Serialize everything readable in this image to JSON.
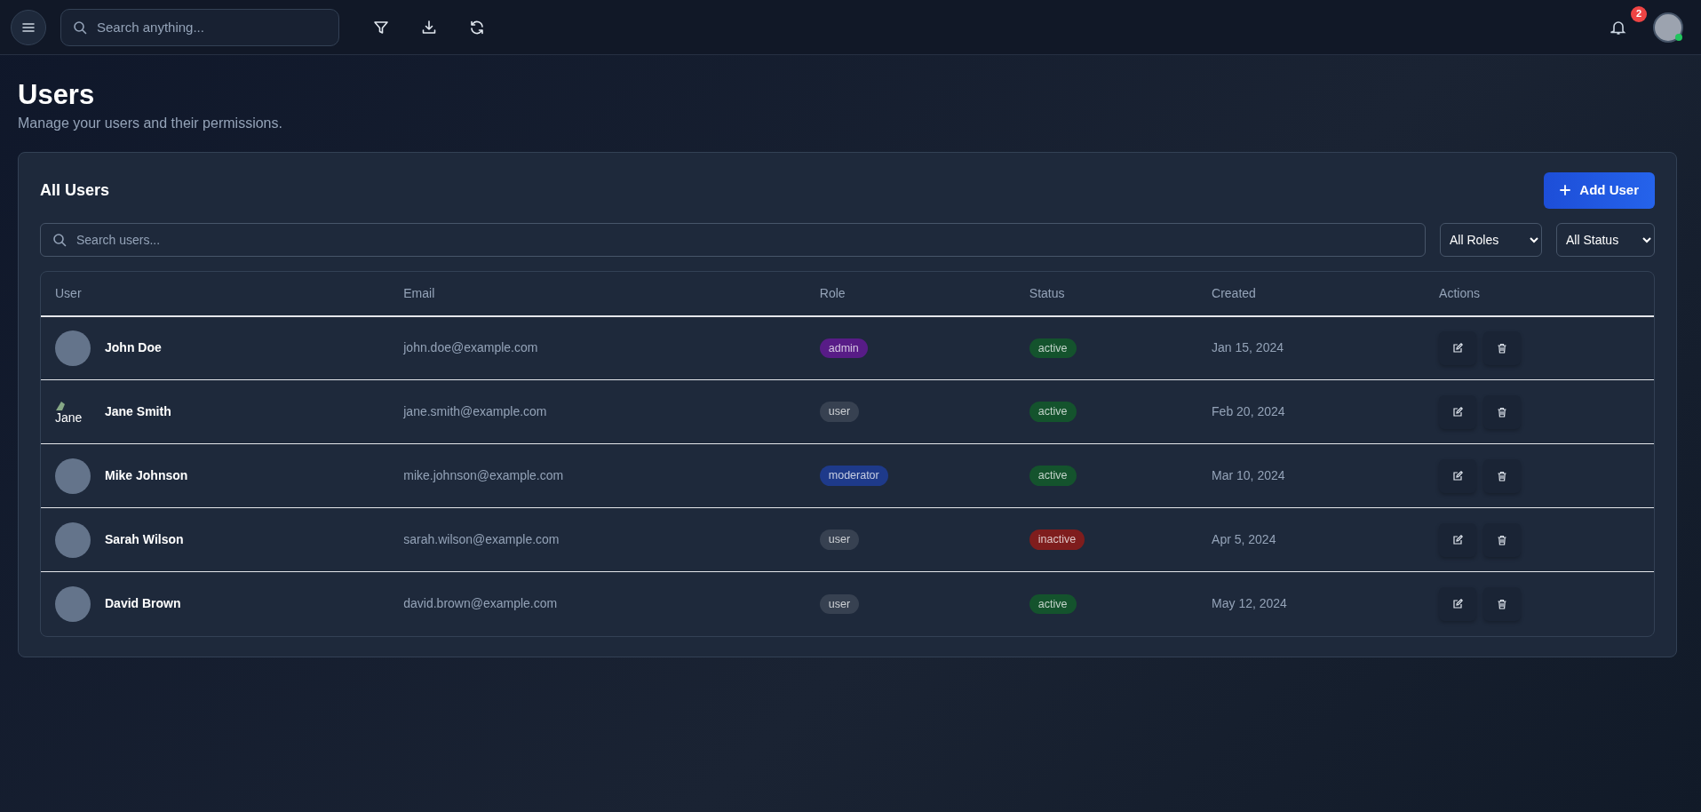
{
  "topbar": {
    "search": {
      "placeholder": "Search anything..."
    },
    "notifications": {
      "count": "2"
    },
    "profile": {
      "online": true
    }
  },
  "header": {
    "title": "Users",
    "subtitle": "Manage your users and their permissions."
  },
  "card": {
    "title": "All Users",
    "add_button": "Add User",
    "search": {
      "placeholder": "Search users..."
    },
    "filters": [
      {
        "value": "All Roles"
      },
      {
        "value": "All Status"
      }
    ]
  },
  "table": {
    "columns": [
      "User",
      "Email",
      "Role",
      "Status",
      "Created",
      "Actions"
    ],
    "rows": [
      {
        "avatar": {
          "kind": "photo"
        },
        "name": "John Doe",
        "email": "john.doe@example.com",
        "role": {
          "text": "admin",
          "color": "#581c87"
        },
        "status": {
          "text": "active",
          "color": "#14532d"
        },
        "created": "Jan 15, 2024"
      },
      {
        "avatar": {
          "kind": "broken",
          "alt": "Jane"
        },
        "name": "Jane Smith",
        "email": "jane.smith@example.com",
        "role": {
          "text": "user",
          "color": "#374151"
        },
        "status": {
          "text": "active",
          "color": "#14532d"
        },
        "created": "Feb 20, 2024"
      },
      {
        "avatar": {
          "kind": "photo"
        },
        "name": "Mike Johnson",
        "email": "mike.johnson@example.com",
        "role": {
          "text": "moderator",
          "color": "#1e3a8a"
        },
        "status": {
          "text": "active",
          "color": "#14532d"
        },
        "created": "Mar 10, 2024"
      },
      {
        "avatar": {
          "kind": "photo"
        },
        "name": "Sarah Wilson",
        "email": "sarah.wilson@example.com",
        "role": {
          "text": "user",
          "color": "#374151"
        },
        "status": {
          "text": "inactive",
          "color": "#7f1d1d"
        },
        "created": "Apr 5, 2024"
      },
      {
        "avatar": {
          "kind": "photo"
        },
        "name": "David Brown",
        "email": "david.brown@example.com",
        "role": {
          "text": "user",
          "color": "#374151"
        },
        "status": {
          "text": "active",
          "color": "#14532d"
        },
        "created": "May 12, 2024"
      }
    ]
  }
}
